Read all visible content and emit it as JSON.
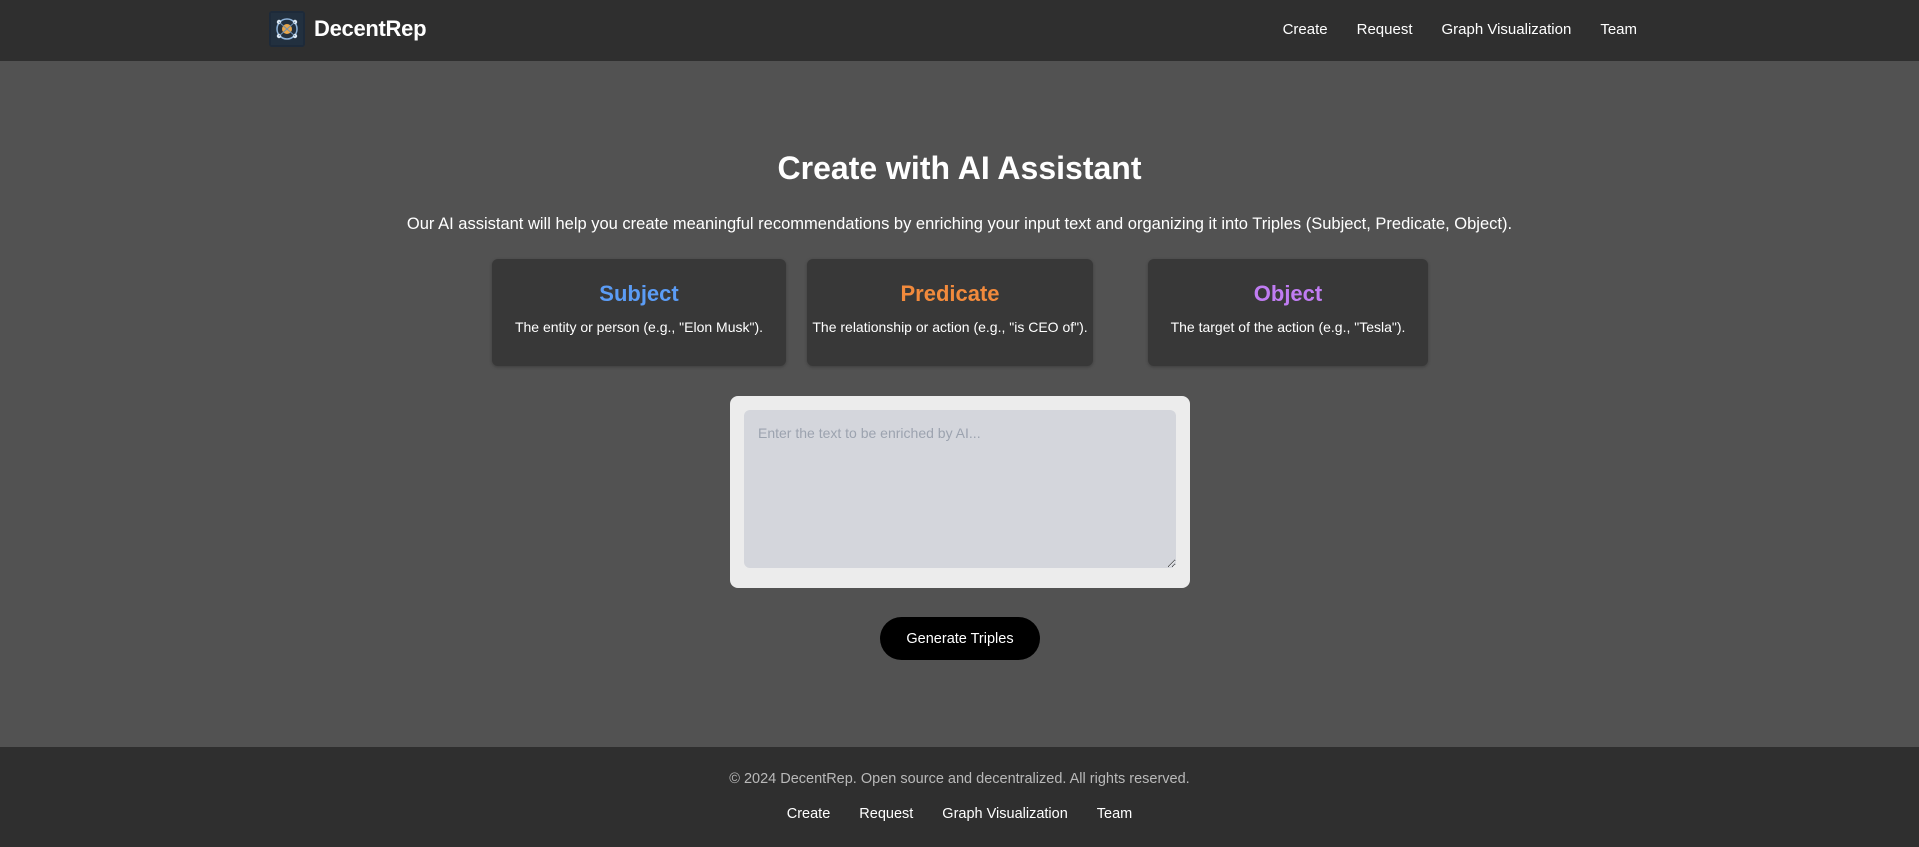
{
  "header": {
    "brand": "DecentRep",
    "logo_icon": "decentrep-logo-icon",
    "nav": [
      "Create",
      "Request",
      "Graph Visualization",
      "Team"
    ]
  },
  "main": {
    "title": "Create with AI Assistant",
    "intro": "Our AI assistant will help you create meaningful recommendations by enriching your input text and organizing it into Triples (Subject, Predicate, Object).",
    "cards": [
      {
        "title": "Subject",
        "description": "The entity or person (e.g., \"Elon Musk\").",
        "color": "#5b9cf5"
      },
      {
        "title": "Predicate",
        "description": "The relationship or action (e.g., \"is CEO of\").",
        "color": "#f28a3c"
      },
      {
        "title": "Object",
        "description": "The target of the action (e.g., \"Tesla\").",
        "color": "#c07cf2"
      }
    ],
    "input": {
      "placeholder": "Enter the text to be enriched by AI...",
      "value": ""
    },
    "generate_button": "Generate Triples"
  },
  "footer": {
    "copyright": "© 2024 DecentRep. Open source and decentralized. All rights reserved.",
    "links": [
      "Create",
      "Request",
      "Graph Visualization",
      "Team"
    ]
  },
  "colors": {
    "background": "#525252",
    "navbar": "#2f2f2f",
    "card": "#383838",
    "button": "#000000"
  }
}
